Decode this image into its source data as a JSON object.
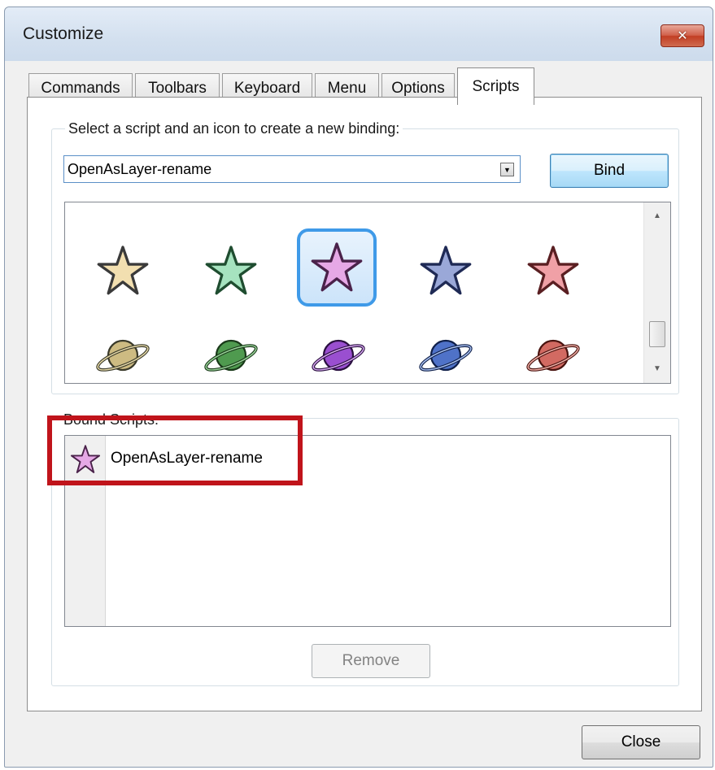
{
  "window": {
    "title": "Customize",
    "close_glyph": "✕"
  },
  "tabs": [
    {
      "label": "Commands",
      "active": false
    },
    {
      "label": "Toolbars",
      "active": false
    },
    {
      "label": "Keyboard",
      "active": false
    },
    {
      "label": "Menu",
      "active": false
    },
    {
      "label": "Options",
      "active": false
    },
    {
      "label": "Scripts",
      "active": true
    }
  ],
  "new_binding": {
    "legend": "Select a script and an icon to create a new binding:",
    "script_select_value": "OpenAsLayer-rename",
    "bind_label": "Bind"
  },
  "icon_gallery": {
    "selected_icon": "star-purple",
    "stars": [
      {
        "name": "star-tan",
        "color": "#f2dfb0"
      },
      {
        "name": "star-green",
        "color": "#a6e3bf"
      },
      {
        "name": "star-purple",
        "color": "#e6a8e6"
      },
      {
        "name": "star-blue",
        "color": "#9aa8d8"
      },
      {
        "name": "star-red",
        "color": "#f0a0a6"
      }
    ],
    "planets": [
      {
        "name": "planet-tan",
        "color": "#cdbb82"
      },
      {
        "name": "planet-green",
        "color": "#4f9a4f"
      },
      {
        "name": "planet-purple",
        "color": "#9a4fd0"
      },
      {
        "name": "planet-blue",
        "color": "#4f72c8"
      },
      {
        "name": "planet-red",
        "color": "#d26a62"
      }
    ]
  },
  "bound_scripts": {
    "legend": "Bound Scripts:",
    "items": [
      {
        "label": "OpenAsLayer-rename",
        "icon": "star-purple"
      }
    ],
    "remove_label": "Remove"
  },
  "footer": {
    "close_label": "Close"
  },
  "annotation": {
    "highlight_color": "#c0141b"
  }
}
